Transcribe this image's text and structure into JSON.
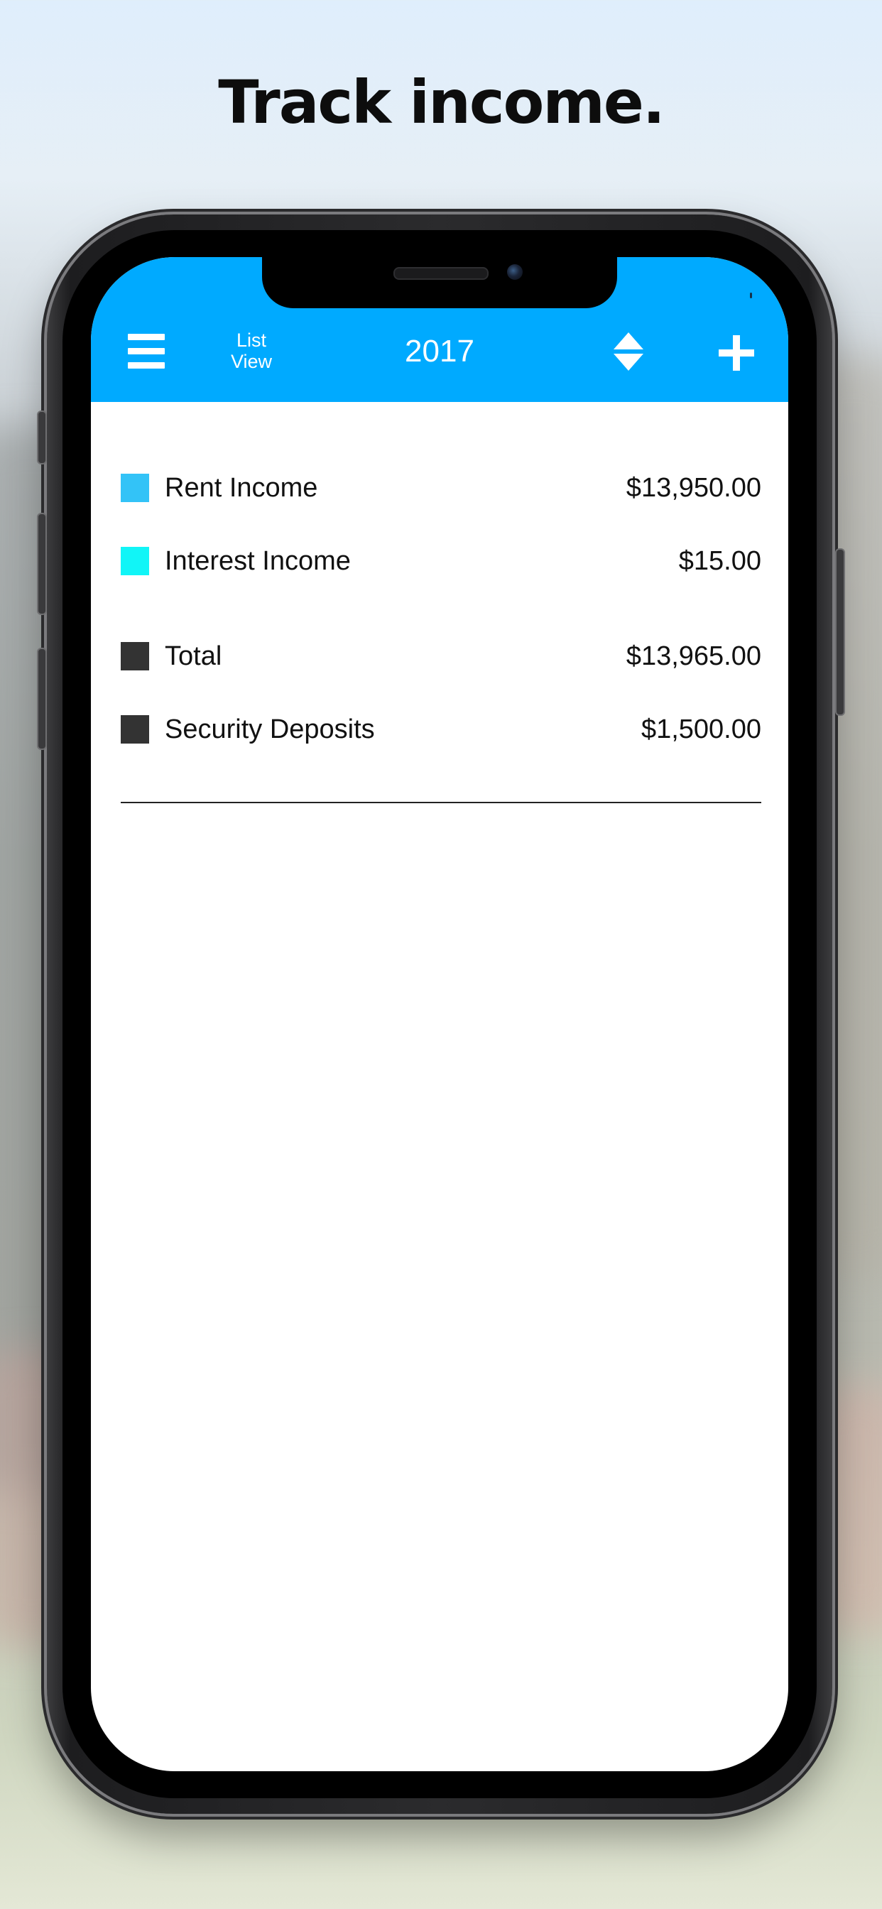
{
  "headline": "Track income.",
  "toolbar": {
    "menu_icon": "hamburger-menu-icon",
    "list_view_line1": "List",
    "list_view_line2": "View",
    "year": "2017",
    "sort_icon": "sort-up-down-icon",
    "add_icon": "plus-icon",
    "color": "#00aaff"
  },
  "rows": [
    {
      "label": "Rent Income",
      "amount": "$13,950.00",
      "color": "#33c3f7"
    },
    {
      "label": "Interest Income",
      "amount": "$15.00",
      "color": "#11f5f7"
    }
  ],
  "summary": [
    {
      "label": "Total",
      "amount": "$13,965.00",
      "color": "#333333"
    },
    {
      "label": "Security Deposits",
      "amount": "$1,500.00",
      "color": "#333333"
    }
  ]
}
